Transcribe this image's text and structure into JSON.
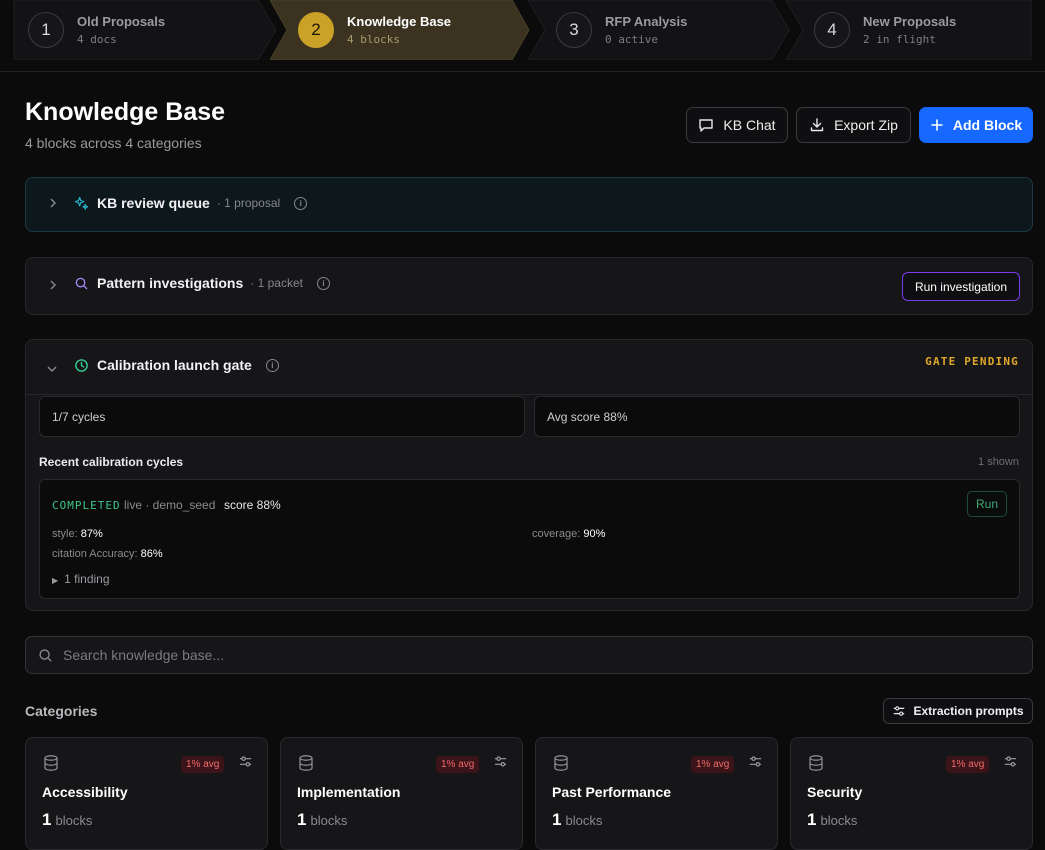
{
  "stepper": [
    {
      "num": "1",
      "title": "Old Proposals",
      "sub": "4 docs",
      "active": false
    },
    {
      "num": "2",
      "title": "Knowledge Base",
      "sub": "4 blocks",
      "active": true
    },
    {
      "num": "3",
      "title": "RFP Analysis",
      "sub": "0 active",
      "active": false
    },
    {
      "num": "4",
      "title": "New Proposals",
      "sub": "2 in flight",
      "active": false
    }
  ],
  "header": {
    "title": "Knowledge Base",
    "subtitle": "4 blocks across 4 categories",
    "kb_chat": "KB Chat",
    "export_zip": "Export Zip",
    "add_block": "Add Block"
  },
  "queue": {
    "title": "KB review queue",
    "meta": "· 1 proposal"
  },
  "patterns": {
    "title": "Pattern investigations",
    "meta": "· 1 packet",
    "button": "Run investigation"
  },
  "calibration": {
    "title": "Calibration launch gate",
    "status": "GATE PENDING",
    "cycles_stat": "1/7 cycles",
    "avg_stat": "Avg score 88%",
    "recent_label": "Recent calibration cycles",
    "shown": "1 shown",
    "cycle": {
      "state": "COMPLETED",
      "meta": "live · demo_seed",
      "score": "score 88%",
      "run": "Run",
      "style_label": "style:",
      "style_value": "87%",
      "coverage_label": "coverage:",
      "coverage_value": "90%",
      "citation_label": "citation Accuracy:",
      "citation_value": "86%",
      "finding": "1 finding"
    }
  },
  "search": {
    "placeholder": "Search knowledge base..."
  },
  "categories": {
    "label": "Categories",
    "extraction_prompts": "Extraction prompts",
    "cards": [
      {
        "name": "Accessibility",
        "avg": "1% avg",
        "count": "1",
        "unit": "blocks"
      },
      {
        "name": "Implementation",
        "avg": "1% avg",
        "count": "1",
        "unit": "blocks"
      },
      {
        "name": "Past Performance",
        "avg": "1% avg",
        "count": "1",
        "unit": "blocks"
      },
      {
        "name": "Security",
        "avg": "1% avg",
        "count": "1",
        "unit": "blocks"
      }
    ]
  },
  "colors": {
    "accent": "#1668ff",
    "active_step": "#c9a227",
    "gate": "#e0a72a",
    "completed": "#3ec68a",
    "purple": "#7c3aed"
  }
}
